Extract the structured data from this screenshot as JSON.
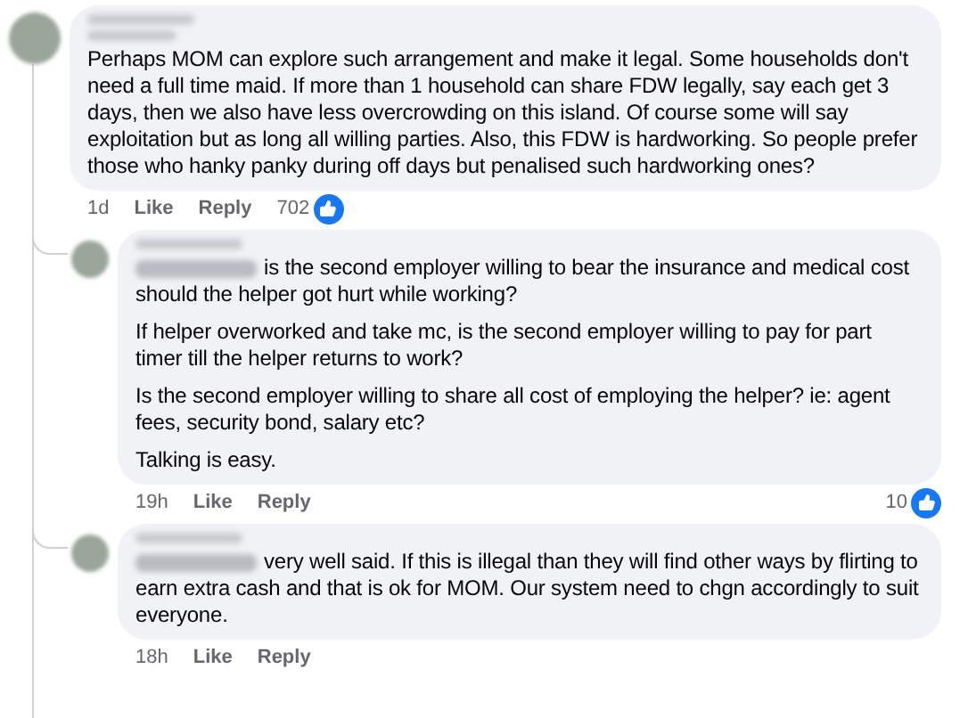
{
  "comments": [
    {
      "kind": "comment",
      "mention": false,
      "paragraphs": [
        "Perhaps MOM can explore such arrangement and make it legal. Some households don't need a full time maid. If more than 1 household can share FDW legally, say each get 3 days, then we also have less overcrowding on this island. Of course some will say exploitation but as long all willing parties. Also, this FDW is hardworking. So people prefer those who hanky panky during off days but penalised such hardworking ones?"
      ],
      "time": "1d",
      "actions": [
        "Like",
        "Reply"
      ],
      "reactions": "702"
    },
    {
      "kind": "reply",
      "mention": true,
      "paragraphs": [
        "is the second employer willing to bear the insurance and medical cost should the helper got hurt while working?",
        "If helper overworked and take mc, is the second employer willing to pay for part timer till the helper returns to work?",
        "Is the second employer willing to share all cost of employing the helper? ie: agent fees, security bond, salary etc?",
        "Talking is easy."
      ],
      "time": "19h",
      "actions": [
        "Like",
        "Reply"
      ],
      "reactions": "10"
    },
    {
      "kind": "reply",
      "mention": true,
      "paragraphs": [
        "very well said. If this is illegal than they will find other ways by flirting to earn extra cash and that is ok for MOM. Our system need to chgn accordingly to suit everyone."
      ],
      "time": "18h",
      "actions": [
        "Like",
        "Reply"
      ]
    }
  ]
}
